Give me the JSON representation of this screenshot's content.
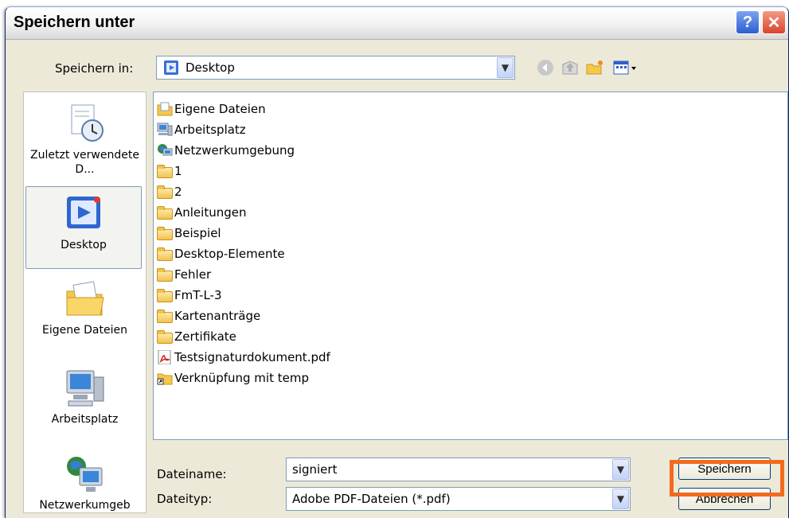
{
  "window": {
    "title": "Speichern unter"
  },
  "titlebar": {
    "help": "?",
    "close": "✕"
  },
  "location": {
    "label": "Speichern in:",
    "value": "Desktop"
  },
  "places": [
    {
      "name": "recent",
      "label": "Zuletzt verwendete D...",
      "icon": "recent-docs-icon"
    },
    {
      "name": "desktop",
      "label": "Desktop",
      "icon": "desktop-icon"
    },
    {
      "name": "my-docs",
      "label": "Eigene Dateien",
      "icon": "my-documents-icon"
    },
    {
      "name": "my-computer",
      "label": "Arbeitsplatz",
      "icon": "my-computer-icon"
    },
    {
      "name": "network",
      "label": "Netzwerkumgeb",
      "icon": "network-icon"
    }
  ],
  "files": [
    {
      "label": "Eigene Dateien",
      "type": "mydocs"
    },
    {
      "label": "Arbeitsplatz",
      "type": "computer"
    },
    {
      "label": "Netzwerkumgebung",
      "type": "network"
    },
    {
      "label": "1",
      "type": "folder"
    },
    {
      "label": "2",
      "type": "folder"
    },
    {
      "label": "Anleitungen",
      "type": "folder"
    },
    {
      "label": "Beispiel",
      "type": "folder"
    },
    {
      "label": "Desktop-Elemente",
      "type": "folder"
    },
    {
      "label": "Fehler",
      "type": "folder"
    },
    {
      "label": "FmT-L-3",
      "type": "folder"
    },
    {
      "label": "Kartenanträge",
      "type": "folder"
    },
    {
      "label": "Zertifikate",
      "type": "folder"
    },
    {
      "label": "Testsignaturdokument.pdf",
      "type": "pdf"
    },
    {
      "label": "Verknüpfung mit temp",
      "type": "shortcut"
    }
  ],
  "filename": {
    "label": "Dateiname:",
    "value": "signiert"
  },
  "filetype": {
    "label": "Dateityp:",
    "value": "Adobe PDF-Dateien (*.pdf)"
  },
  "buttons": {
    "save": "Speichern",
    "cancel": "Abbrechen"
  },
  "colors": {
    "highlight": "#f26b1d",
    "selection_border": "#7f9db9"
  }
}
